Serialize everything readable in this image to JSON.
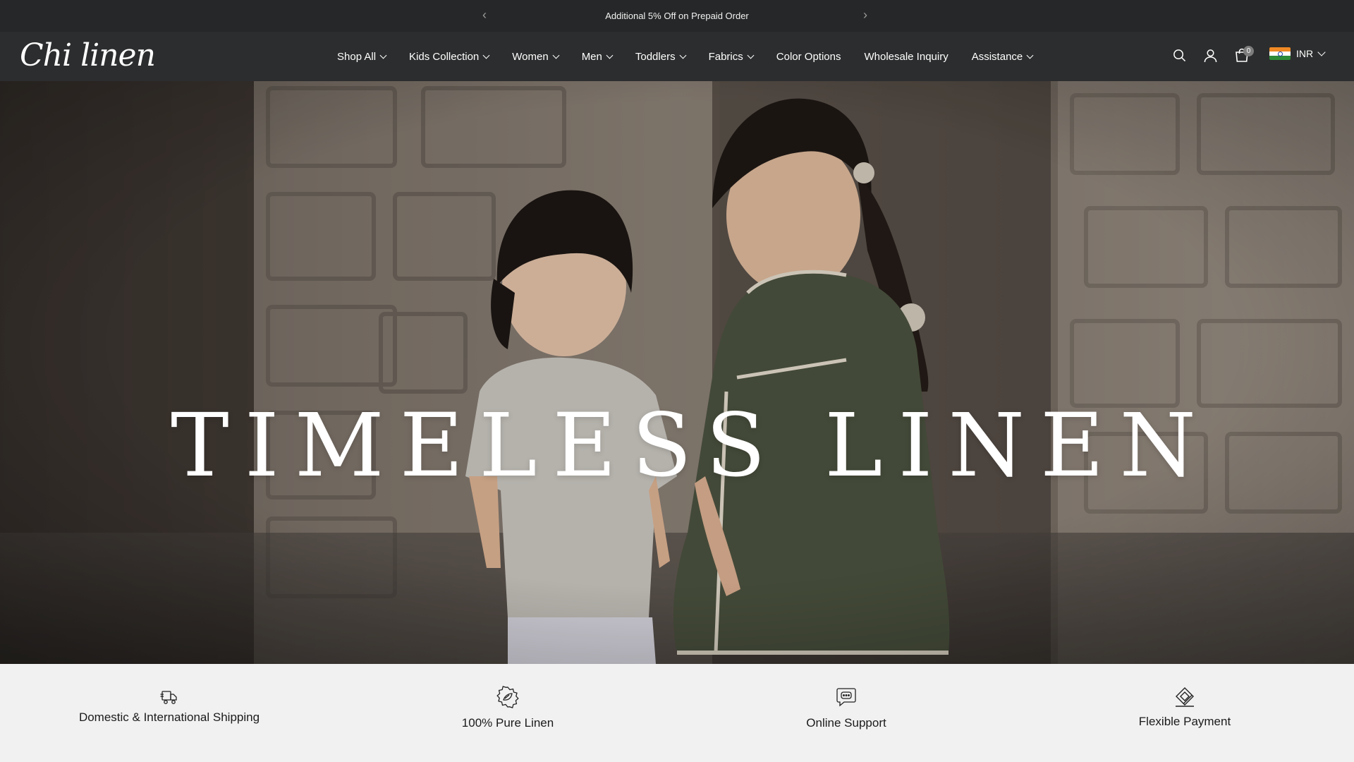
{
  "announcement": {
    "text": "Additional 5% Off on Prepaid Order",
    "prev_icon": "chevron-left-icon",
    "next_icon": "chevron-right-icon"
  },
  "header": {
    "logo": "Chi linen",
    "nav": [
      {
        "label": "Shop All",
        "has_dropdown": true
      },
      {
        "label": "Kids Collection",
        "has_dropdown": true
      },
      {
        "label": "Women",
        "has_dropdown": true
      },
      {
        "label": "Men",
        "has_dropdown": true
      },
      {
        "label": "Toddlers",
        "has_dropdown": true
      },
      {
        "label": "Fabrics",
        "has_dropdown": true
      },
      {
        "label": "Color Options",
        "has_dropdown": false
      },
      {
        "label": "Wholesale Inquiry",
        "has_dropdown": false
      },
      {
        "label": "Assistance",
        "has_dropdown": true
      }
    ],
    "cart_count": "0",
    "currency": "INR"
  },
  "hero": {
    "title": "TIMELESS LINEN"
  },
  "features": [
    {
      "label": "Domestic & International Shipping",
      "icon": "delivery-truck-icon"
    },
    {
      "label": "100% Pure Linen",
      "icon": "leaf-badge-icon"
    },
    {
      "label": "Online Support",
      "icon": "chat-bubble-icon"
    },
    {
      "label": "Flexible Payment",
      "icon": "card-payment-icon"
    }
  ],
  "colors": {
    "announcement_bg": "#262728",
    "header_bg": "#2c2d2e",
    "features_bg": "#f1f1f1"
  }
}
